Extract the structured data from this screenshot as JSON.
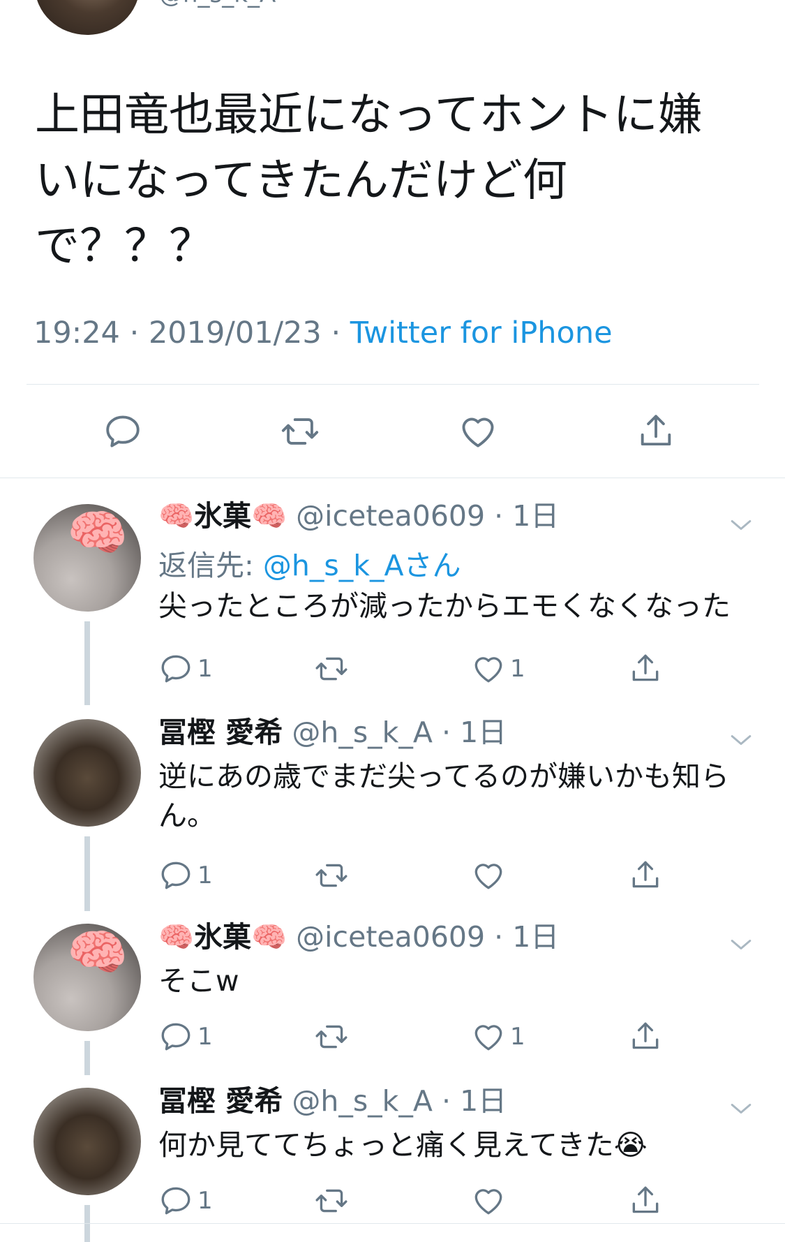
{
  "main_tweet": {
    "handle": "@h_s_k_A",
    "text_lines": [
      "上田竜也最近になってホントに嫌",
      "いになってきたんだけど何",
      "で？？？"
    ],
    "time": "19:24",
    "date": "2019/01/23",
    "source": "Twitter for iPhone"
  },
  "replies": [
    {
      "name": "🧠氷菓🧠",
      "handle": "@icetea0609",
      "time": "1日",
      "reply_to_label": "返信先: ",
      "reply_to_handle": "@h_s_k_Aさん",
      "text_lines": [
        "尖ったところが減ったからエモくなくなった"
      ],
      "replies_count": "1",
      "likes_count": "1"
    },
    {
      "name": "冨樫 愛希",
      "handle": "@h_s_k_A",
      "time": "1日",
      "text_lines": [
        "逆にあの歳でまだ尖ってるのが嫌いかも知ら",
        "ん。"
      ],
      "replies_count": "1",
      "likes_count": ""
    },
    {
      "name": "🧠氷菓🧠",
      "handle": "@icetea0609",
      "time": "1日",
      "text_lines": [
        "そこw"
      ],
      "replies_count": "1",
      "likes_count": "1"
    },
    {
      "name": "冨樫 愛希",
      "handle": "@h_s_k_A",
      "time": "1日",
      "text_lines": [
        "何か見ててちょっと痛く見えてきた😭"
      ],
      "replies_count": "1",
      "likes_count": ""
    }
  ],
  "separator": " · ",
  "colors": {
    "accent": "#1b95e0",
    "secondary": "#657786",
    "text": "#14171a",
    "divider": "#e1e8ed"
  },
  "icons": [
    "reply-icon",
    "retweet-icon",
    "like-icon",
    "share-icon",
    "chevron-down-icon"
  ]
}
